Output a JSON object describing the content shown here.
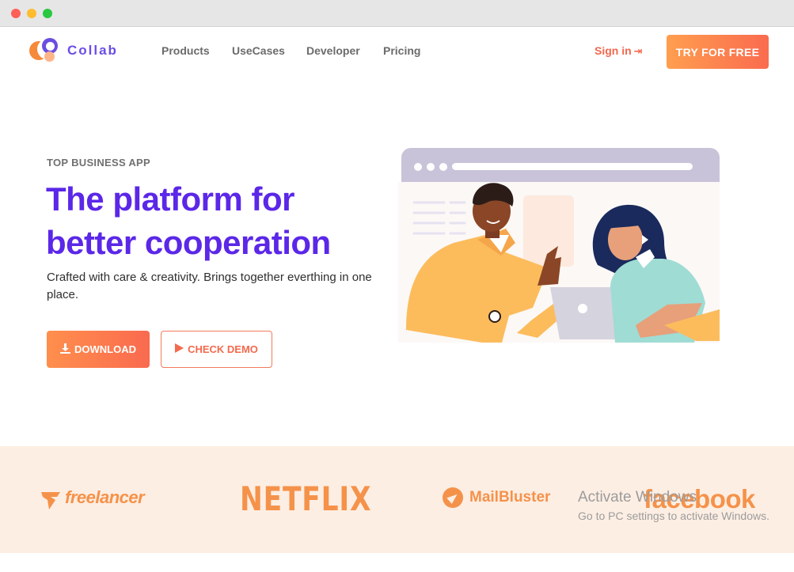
{
  "window": {
    "controls": [
      "close",
      "minimize",
      "maximize"
    ]
  },
  "brand": {
    "name": "Collab",
    "colors": {
      "primary": "#5b27e8",
      "accent": "#fa6b4f",
      "orange": "#ff9e4f",
      "band": "#fdeee3"
    }
  },
  "nav": {
    "items": [
      {
        "label": "Products"
      },
      {
        "label": "UseCases"
      },
      {
        "label": "Developer"
      },
      {
        "label": "Pricing"
      }
    ],
    "signin_label": "Sign in",
    "signin_icon": "sign-in-icon",
    "cta_label": "TRY FOR FREE"
  },
  "hero": {
    "eyebrow": "TOP BUSINESS APP",
    "title_line1": "The platform for",
    "title_line2": "better cooperation",
    "subtitle": "Crafted with care & creativity. Brings together everthing in one place.",
    "download_label": "DOWNLOAD",
    "download_icon": "download-icon",
    "demo_label": "CHECK DEMO",
    "demo_icon": "play-icon"
  },
  "partners": [
    {
      "name": "freelancer"
    },
    {
      "name": "NETFLIX"
    },
    {
      "name": "MailBluster"
    },
    {
      "name": "facebook"
    }
  ],
  "watermark": {
    "line1": "Activate Windows",
    "line2": "Go to PC settings to activate Windows."
  }
}
